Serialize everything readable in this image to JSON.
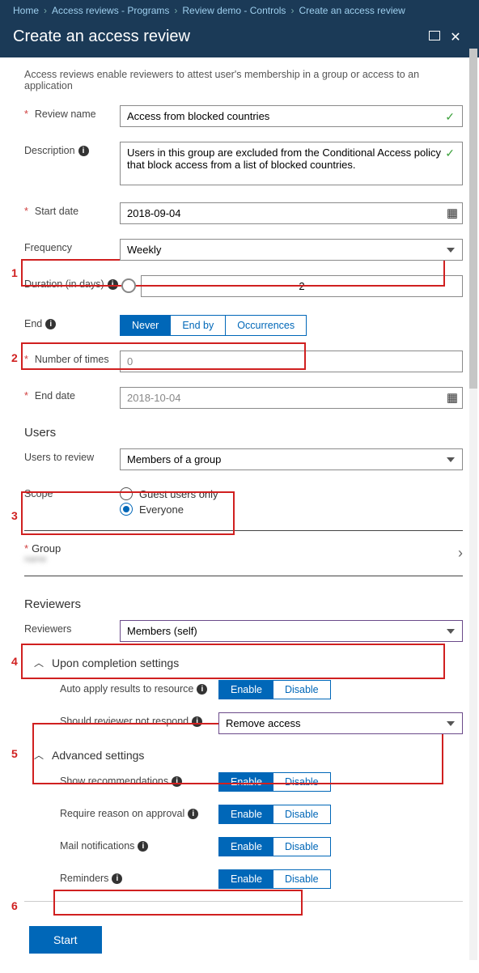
{
  "breadcrumb": [
    "Home",
    "Access reviews - Programs",
    "Review demo - Controls",
    "Create an access review"
  ],
  "title": "Create an access review",
  "intro": "Access reviews enable reviewers to attest user's membership in a group or access to an application",
  "labels": {
    "review_name": "Review name",
    "description": "Description",
    "start_date": "Start date",
    "frequency": "Frequency",
    "duration": "Duration (in days)",
    "end": "End",
    "num_times": "Number of times",
    "end_date": "End date",
    "users_h": "Users",
    "users_to_review": "Users to review",
    "scope": "Scope",
    "group": "Group",
    "reviewers_h": "Reviewers",
    "reviewers": "Reviewers",
    "completion_h": "Upon completion settings",
    "auto_apply": "Auto apply results to resource",
    "no_respond": "Should reviewer not respond",
    "advanced_h": "Advanced settings",
    "show_rec": "Show recommendations",
    "req_reason": "Require reason on approval",
    "mail": "Mail notifications",
    "reminders": "Reminders"
  },
  "values": {
    "review_name": "Access from blocked countries",
    "description": "Users in this group are excluded from the Conditional Access policy that block access from a list of blocked countries.",
    "start_date": "2018-09-04",
    "frequency": "Weekly",
    "duration": "2",
    "num_times": "0",
    "end_date": "2018-10-04",
    "users_to_review": "Members of a group",
    "reviewers": "Members (self)",
    "no_respond": "Remove access"
  },
  "end_options": {
    "never": "Never",
    "endby": "End by",
    "occ": "Occurrences",
    "selected": "never"
  },
  "scope_options": {
    "guest": "Guest users only",
    "everyone": "Everyone",
    "selected": "everyone"
  },
  "toggle": {
    "enable": "Enable",
    "disable": "Disable"
  },
  "annotations": {
    "a1": "1",
    "a2": "2",
    "a3": "3",
    "a4": "4",
    "a5": "5",
    "a6": "6"
  },
  "buttons": {
    "start": "Start"
  }
}
